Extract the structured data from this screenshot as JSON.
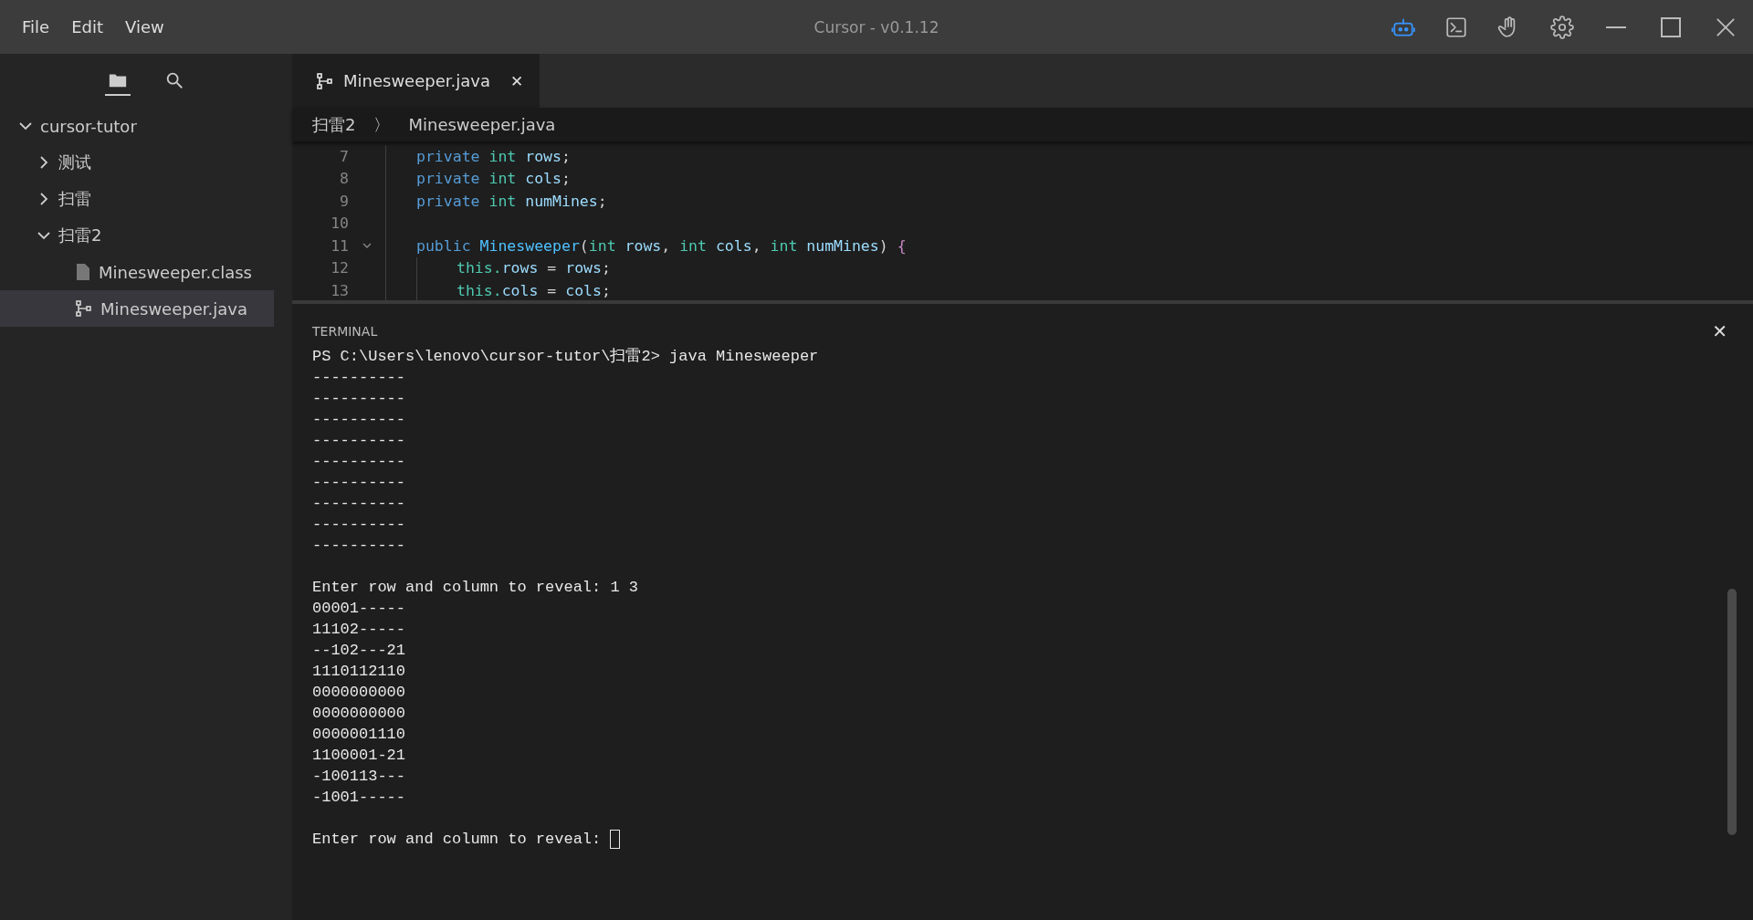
{
  "window": {
    "title": "Cursor - v0.1.12"
  },
  "menu": [
    "File",
    "Edit",
    "View"
  ],
  "toolbar": [
    {
      "kind": "robot",
      "selected": true
    },
    {
      "kind": "terminal",
      "selected": false
    },
    {
      "kind": "hand",
      "selected": false
    },
    {
      "kind": "gear",
      "selected": false
    }
  ],
  "sidebar": {
    "tabs": [
      {
        "kind": "folder",
        "selected": true
      },
      {
        "kind": "search",
        "selected": false
      }
    ],
    "tree": [
      {
        "label": "cursor-tutor",
        "kind": "folder",
        "expanded": true,
        "selected": false,
        "children": [
          {
            "label": "测试",
            "kind": "folder",
            "expanded": false,
            "selected": false
          },
          {
            "label": "扫雷",
            "kind": "folder",
            "expanded": false,
            "selected": false
          },
          {
            "label": "扫雷2",
            "kind": "folder",
            "expanded": true,
            "selected": false,
            "children": [
              {
                "label": "Minesweeper.class",
                "kind": "file",
                "selected": false
              },
              {
                "label": "Minesweeper.java",
                "kind": "source",
                "selected": true
              }
            ]
          }
        ]
      }
    ]
  },
  "editor": {
    "tabs": [
      {
        "label": "Minesweeper.java",
        "selected": true,
        "close": "✕"
      }
    ],
    "breadcrumb": [
      "扫雷2",
      "〉",
      "Minesweeper.java"
    ],
    "lines": [
      {
        "number": "7",
        "fold": false,
        "tokens": [
          {
            "text": "private ",
            "color": "#569cd6"
          },
          {
            "text": "int ",
            "color": "#4ec9b0"
          },
          {
            "text": "rows",
            "color": "#9cdcfe"
          },
          {
            "text": ";",
            "color": "#d4d4d4"
          }
        ]
      },
      {
        "number": "8",
        "fold": false,
        "tokens": [
          {
            "text": "private ",
            "color": "#569cd6"
          },
          {
            "text": "int ",
            "color": "#4ec9b0"
          },
          {
            "text": "cols",
            "color": "#9cdcfe"
          },
          {
            "text": ";",
            "color": "#d4d4d4"
          }
        ]
      },
      {
        "number": "9",
        "fold": false,
        "tokens": [
          {
            "text": "private ",
            "color": "#569cd6"
          },
          {
            "text": "int ",
            "color": "#4ec9b0"
          },
          {
            "text": "numMines",
            "color": "#9cdcfe"
          },
          {
            "text": ";",
            "color": "#d4d4d4"
          }
        ]
      },
      {
        "number": "10",
        "fold": false
      },
      {
        "number": "11",
        "fold": true,
        "tokens": [
          {
            "text": "public ",
            "color": "#569cd6"
          },
          {
            "text": "Minesweeper",
            "color": "#4fc1ff"
          },
          {
            "text": "(",
            "color": "#d4d4d4"
          },
          {
            "text": "int ",
            "color": "#4ec9b0"
          },
          {
            "text": "rows",
            "color": "#9cdcfe"
          },
          {
            "text": ", ",
            "color": "#d4d4d4"
          },
          {
            "text": "int ",
            "color": "#4ec9b0"
          },
          {
            "text": "cols",
            "color": "#9cdcfe"
          },
          {
            "text": ", ",
            "color": "#d4d4d4"
          },
          {
            "text": "int ",
            "color": "#4ec9b0"
          },
          {
            "text": "numMines",
            "color": "#9cdcfe"
          },
          {
            "text": ") ",
            "color": "#d4d4d4"
          },
          {
            "text": "{",
            "color": "#c586c0"
          }
        ],
        "children": [
          {
            "number": "12",
            "fold": false,
            "tokens": [
              {
                "text": "this.",
                "color": "#4ec9b0"
              },
              {
                "text": "rows",
                "color": "#9cdcfe"
              },
              {
                "text": " = ",
                "color": "#d4d4d4"
              },
              {
                "text": "rows",
                "color": "#9cdcfe"
              },
              {
                "text": ";",
                "color": "#d4d4d4"
              }
            ]
          },
          {
            "number": "13",
            "fold": false,
            "tokens": [
              {
                "text": "this.",
                "color": "#4ec9b0"
              },
              {
                "text": "cols",
                "color": "#9cdcfe"
              },
              {
                "text": " = ",
                "color": "#d4d4d4"
              },
              {
                "text": "cols",
                "color": "#9cdcfe"
              },
              {
                "text": ";",
                "color": "#d4d4d4"
              }
            ]
          }
        ]
      }
    ]
  },
  "terminal": {
    "title": "TERMINAL",
    "close": "✕",
    "blocks": [
      [
        "PS C:\\Users\\lenovo\\cursor-tutor\\扫雷2> java Minesweeper",
        "----------",
        "----------",
        "----------",
        "----------",
        "----------",
        "----------",
        "----------",
        "----------",
        "----------"
      ],
      [
        "Enter row and column to reveal: 1 3",
        "00001-----",
        "11102-----",
        "--102---21",
        "1110112110",
        "0000000000",
        "0000000000",
        "0000001110",
        "1100001-21",
        "-100113---",
        "-1001-----"
      ]
    ],
    "prompt": {
      "text": "Enter row and column to reveal:",
      "cursor": true
    }
  }
}
